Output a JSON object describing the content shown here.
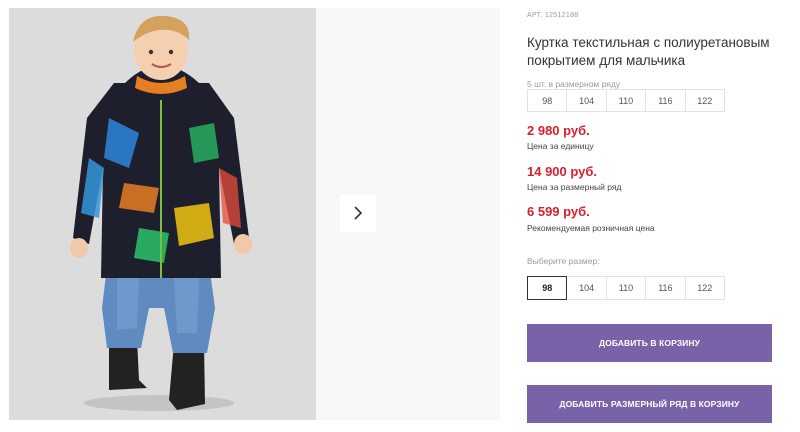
{
  "product": {
    "sku": "АРТ. 12512188",
    "title": "Куртка текстильная с полиуретановым покрытием для мальчика"
  },
  "pack": {
    "label": "5 шт. в размерном ряду",
    "sizes": [
      "98",
      "104",
      "110",
      "116",
      "122"
    ]
  },
  "prices": {
    "unit_price": "2 980 руб.",
    "unit_label": "Цена за единицу",
    "pack_price": "14 900 руб.",
    "pack_label": "Цена за размерный ряд",
    "retail_price": "6 599 руб.",
    "retail_label": "Рекомендуемая розничная цена"
  },
  "size_picker": {
    "label": "Выберите размер:",
    "sizes": [
      "98",
      "104",
      "110",
      "116",
      "122"
    ],
    "selected": "98"
  },
  "buttons": {
    "add_to_cart": "ДОБАВИТЬ В КОРЗИНУ",
    "add_pack_to_cart": "ДОБАВИТЬ РАЗМЕРНЫЙ РЯД В КОРЗИНУ"
  },
  "gallery": {
    "next_icon": "chevron-right-icon"
  },
  "colors": {
    "price": "#d6202f",
    "button": "#7a62a8"
  }
}
